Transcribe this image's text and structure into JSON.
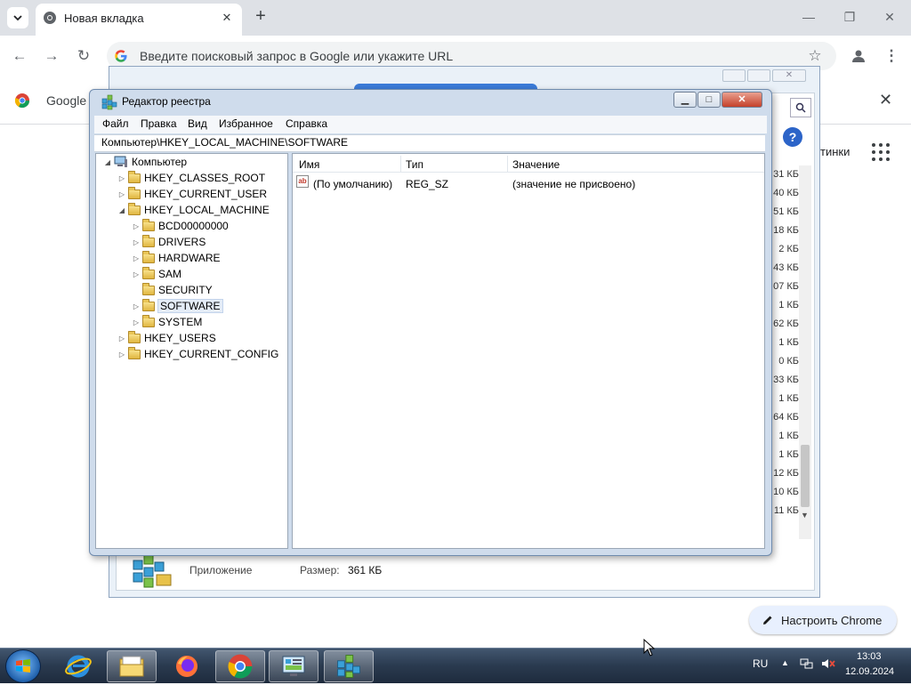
{
  "browser": {
    "tab_title": "Новая вкладка",
    "omnibox_placeholder": "Введите поисковый запрос в Google или укажите URL",
    "infobar_text": "Google",
    "apps_label": "тинки",
    "customize_label": "Настроить Chrome"
  },
  "background_dialog": {
    "sizes": [
      "31 КБ",
      "40 КБ",
      "51 КБ",
      "18 КБ",
      "2 КБ",
      "43 КБ",
      "07 КБ",
      "1 КБ",
      "62 КБ",
      "1 КБ",
      "0 КБ",
      "33 КБ",
      "1 КБ",
      "64 КБ",
      "1 КБ",
      "1 КБ",
      "12 КБ",
      "10 КБ",
      "11 КБ"
    ],
    "type_label": "Приложение",
    "size_label": "Размер:",
    "size_value": "361 КБ"
  },
  "regedit": {
    "title": "Редактор реестра",
    "menu": [
      "Файл",
      "Правка",
      "Вид",
      "Избранное",
      "Справка"
    ],
    "address": "Компьютер\\HKEY_LOCAL_MACHINE\\SOFTWARE",
    "tree": {
      "root": "Компьютер",
      "hives": [
        "HKEY_CLASSES_ROOT",
        "HKEY_CURRENT_USER",
        "HKEY_LOCAL_MACHINE"
      ],
      "hklm_children": [
        "BCD00000000",
        "DRIVERS",
        "HARDWARE",
        "SAM",
        "SECURITY",
        "SOFTWARE",
        "SYSTEM"
      ],
      "hives_after": [
        "HKEY_USERS",
        "HKEY_CURRENT_CONFIG"
      ],
      "selected": "SOFTWARE"
    },
    "columns": {
      "name": "Имя",
      "type": "Тип",
      "value": "Значение"
    },
    "rows": [
      {
        "name": "(По умолчанию)",
        "type": "REG_SZ",
        "value": "(значение не присвоено)",
        "icon": "string-value-icon"
      }
    ]
  },
  "taskbar": {
    "language": "RU",
    "time": "13:03",
    "date": "12.09.2024"
  }
}
